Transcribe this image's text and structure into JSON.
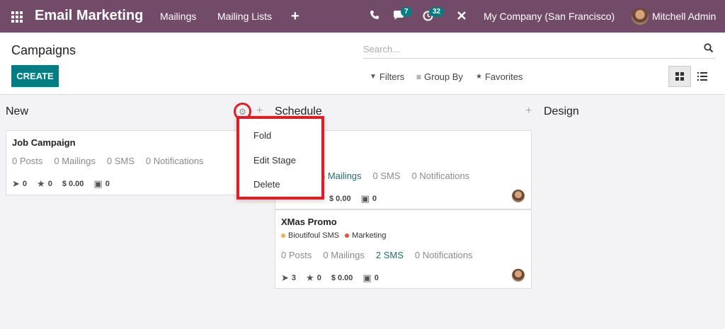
{
  "navbar": {
    "brand": "Email Marketing",
    "menu": [
      "Mailings",
      "Mailing Lists"
    ],
    "plus_icon": "+",
    "phone_icon": "phone-icon",
    "messages_icon": "chat-icon",
    "messages_badge": "7",
    "activities_icon": "clock-icon",
    "activities_badge": "32",
    "tools_icon": "close-icon",
    "company": "My Company (San Francisco)",
    "user": "Mitchell Admin"
  },
  "control_panel": {
    "title": "Campaigns",
    "search_placeholder": "Search...",
    "create_label": "CREATE",
    "filters_label": "Filters",
    "groupby_label": "Group By",
    "favorites_label": "Favorites"
  },
  "kanban": {
    "columns": [
      {
        "title": "New"
      },
      {
        "title": "Schedule"
      },
      {
        "title": "Design"
      }
    ],
    "cards": [
      {
        "title": "Job Campaign",
        "stats": [
          "0 Posts",
          "0 Mailings",
          "0 SMS",
          "0 Notifications"
        ],
        "metrics": [
          "0",
          "0",
          "$ 0.00",
          "0"
        ]
      },
      {
        "title": "",
        "stats": [
          "3 Mailings",
          "0 SMS",
          "0 Notifications"
        ],
        "metrics": [
          "$ 0.00",
          "0"
        ]
      },
      {
        "title": "XMas Promo",
        "tags": [
          {
            "label": "Bioutifoul SMS",
            "color": "#f0ad4e"
          },
          {
            "label": "Marketing",
            "color": "#e8542d"
          }
        ],
        "stats": [
          "0 Posts",
          "0 Mailings",
          "2 SMS",
          "0 Notifications"
        ],
        "metrics": [
          "3",
          "0",
          "$ 0.00",
          "0"
        ]
      }
    ]
  },
  "stage_menu": {
    "items": [
      "Fold",
      "Edit Stage",
      "Delete"
    ]
  },
  "colors": {
    "navbar": "#714b67",
    "primary": "#017e84",
    "highlight": "#e31b23"
  }
}
